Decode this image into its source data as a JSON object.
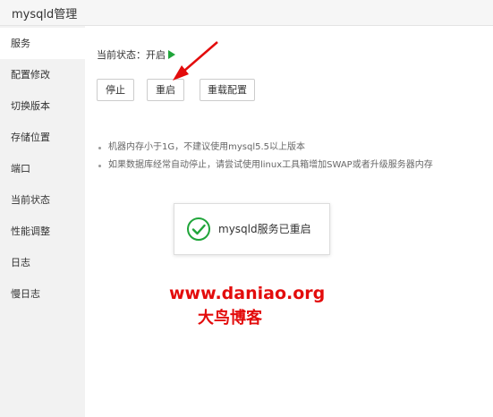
{
  "window": {
    "title": "mysqld管理"
  },
  "sidebar": {
    "items": [
      {
        "label": "服务",
        "active": true
      },
      {
        "label": "配置修改"
      },
      {
        "label": "切换版本"
      },
      {
        "label": "存储位置"
      },
      {
        "label": "端口"
      },
      {
        "label": "当前状态"
      },
      {
        "label": "性能调整"
      },
      {
        "label": "日志"
      },
      {
        "label": "慢日志"
      }
    ]
  },
  "service": {
    "status_label": "当前状态：开启",
    "buttons": {
      "stop": "停止",
      "restart": "重启",
      "reload": "重载配置"
    },
    "tips": [
      "机器内存小于1G，不建议使用mysql5.5以上版本",
      "如果数据库经常自动停止，请尝试使用linux工具箱增加SWAP或者升级服务器内存"
    ]
  },
  "toast": {
    "message": "mysqld服务已重启"
  },
  "watermark": {
    "line1": "www.daniao.org",
    "line2": "大鸟博客"
  },
  "colors": {
    "accent_green": "#20a53a",
    "annotation_red": "#e30c0c"
  }
}
